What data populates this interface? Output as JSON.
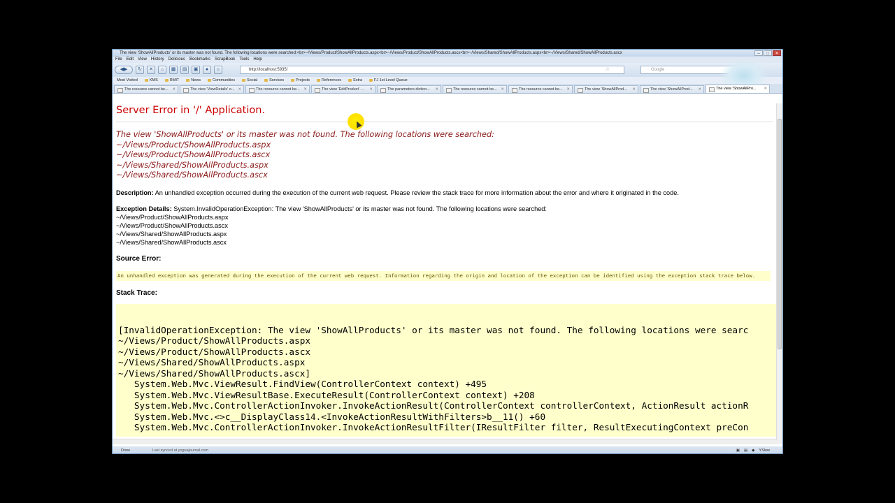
{
  "window": {
    "title": "The view 'ShowAllProducts' or its master was not found. The following locations were searched:<br>~/Views/Product/ShowAllProducts.aspx<br>~/Views/Product/ShowAllProducts.ascx<br>~/Views/Shared/ShowAllProducts.aspx<br>~/Views/Shared/ShowAllProducts.ascx"
  },
  "menu": [
    "File",
    "Edit",
    "View",
    "History",
    "Delicious",
    "Bookmarks",
    "ScrapBook",
    "Tools",
    "Help"
  ],
  "nav": {
    "url": "http://localhost:5935/",
    "search_placeholder": "Google"
  },
  "bookmarks": [
    "Most Visited",
    "KMS",
    "RMIT",
    "News",
    "Communities",
    "Social",
    "Services",
    "Projects",
    "References",
    "Extra",
    "FJ 1st Level Queue"
  ],
  "tabs": [
    {
      "label": "The resource cannot be...",
      "active": false
    },
    {
      "label": "The view 'ViewDetails' o...",
      "active": false
    },
    {
      "label": "The resource cannot be...",
      "active": false
    },
    {
      "label": "The view 'EditProduct' ...",
      "active": false
    },
    {
      "label": "The parameters diction...",
      "active": false
    },
    {
      "label": "The resource cannot be...",
      "active": false
    },
    {
      "label": "The resource cannot be...",
      "active": false
    },
    {
      "label": "The view 'ShowAllProd...",
      "active": false
    },
    {
      "label": "The view 'ShowAllProd...",
      "active": false
    },
    {
      "label": "The view 'ShowAllPro...",
      "active": true
    }
  ],
  "page": {
    "heading": "Server Error in '/' Application.",
    "error_message": "The view 'ShowAllProducts' or its master was not found. The following locations were searched:",
    "error_paths": [
      "~/Views/Product/ShowAllProducts.aspx",
      "~/Views/Product/ShowAllProducts.ascx",
      "~/Views/Shared/ShowAllProducts.aspx",
      "~/Views/Shared/ShowAllProducts.ascx"
    ],
    "description_label": "Description:",
    "description_text": " An unhandled exception occurred during the execution of the current web request. Please review the stack trace for more information about the error and where it originated in the code.",
    "exception_label": "Exception Details:",
    "exception_text": " System.InvalidOperationException: The view 'ShowAllProducts' or its master was not found. The following locations were searched:",
    "exception_paths": [
      "~/Views/Product/ShowAllProducts.aspx",
      "~/Views/Product/ShowAllProducts.ascx",
      "~/Views/Shared/ShowAllProducts.aspx",
      "~/Views/Shared/ShowAllProducts.ascx"
    ],
    "source_error_label": "Source Error:",
    "source_error_text": "An unhandled exception was generated during the execution of the current web request. Information regarding the origin and location of the exception can be identified using the exception stack trace below.",
    "stack_trace_label": "Stack Trace:",
    "stack_trace": [
      "[InvalidOperationException: The view 'ShowAllProducts' or its master was not found. The following locations were searc",
      "~/Views/Product/ShowAllProducts.aspx",
      "~/Views/Product/ShowAllProducts.ascx",
      "~/Views/Shared/ShowAllProducts.aspx",
      "~/Views/Shared/ShowAllProducts.ascx]",
      "   System.Web.Mvc.ViewResult.FindView(ControllerContext context) +495",
      "   System.Web.Mvc.ViewResultBase.ExecuteResult(ControllerContext context) +208",
      "   System.Web.Mvc.ControllerActionInvoker.InvokeActionResult(ControllerContext controllerContext, ActionResult actionR",
      "   System.Web.Mvc.<>c__DisplayClass14.<InvokeActionResultWithFilters>b__11() +60",
      "   System.Web.Mvc.ControllerActionInvoker.InvokeActionResultFilter(IResultFilter filter, ResultExecutingContext preCon"
    ]
  },
  "status": {
    "left": "Done",
    "sync": "Last synced at yoguajournal.com",
    "right": [
      "YSlow"
    ]
  },
  "colors": {
    "heading": "#cc0000",
    "error_message": "#8b1a1a",
    "code_background": "#ffffcc"
  }
}
